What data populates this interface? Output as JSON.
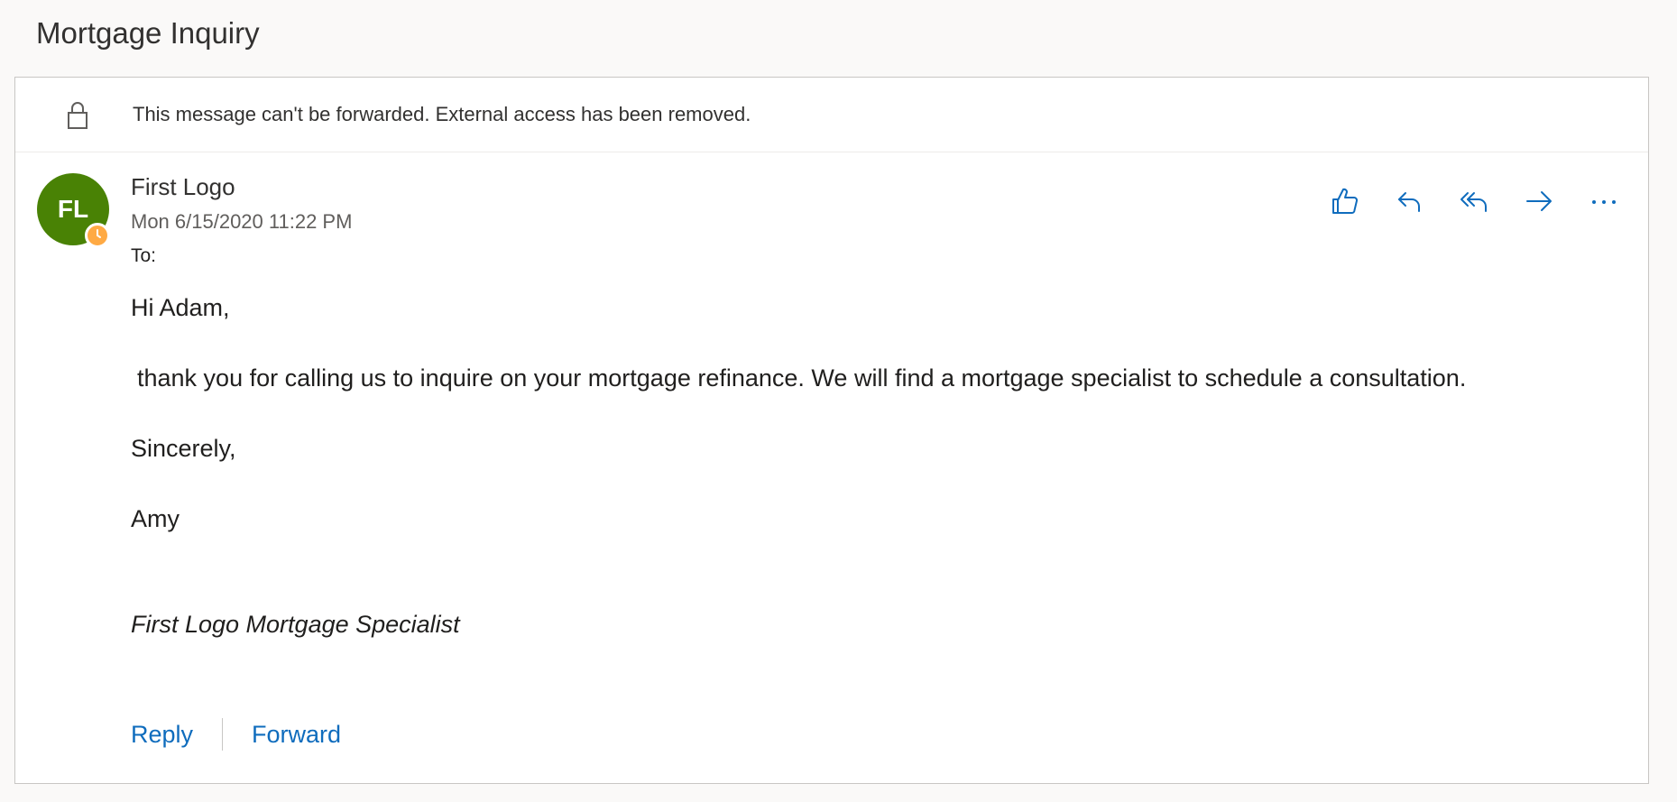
{
  "subject": "Mortgage Inquiry",
  "infobar": {
    "icon": "lock-icon",
    "text": "This message can't be forwarded. External access has been removed."
  },
  "message": {
    "avatar_initials": "FL",
    "avatar_color": "#498205",
    "presence_color": "#ffaa44",
    "sender": "First Logo",
    "date": "Mon 6/15/2020 11:22 PM",
    "to_label": "To:",
    "actions": [
      {
        "name": "like",
        "icon": "thumbs-up-icon"
      },
      {
        "name": "reply",
        "icon": "reply-icon"
      },
      {
        "name": "reply-all",
        "icon": "reply-all-icon"
      },
      {
        "name": "forward",
        "icon": "forward-icon"
      },
      {
        "name": "more",
        "icon": "more-icon"
      }
    ],
    "body": {
      "greeting": "Hi Adam,",
      "main": "thank you for calling us to inquire on your mortgage refinance.  We will find a mortgage specialist to schedule a consultation.",
      "closing": "Sincerely,",
      "name": "Amy",
      "title": "First Logo Mortgage Specialist"
    }
  },
  "footer": {
    "reply_label": "Reply",
    "forward_label": "Forward"
  },
  "colors": {
    "accent": "#0f6cbd"
  }
}
